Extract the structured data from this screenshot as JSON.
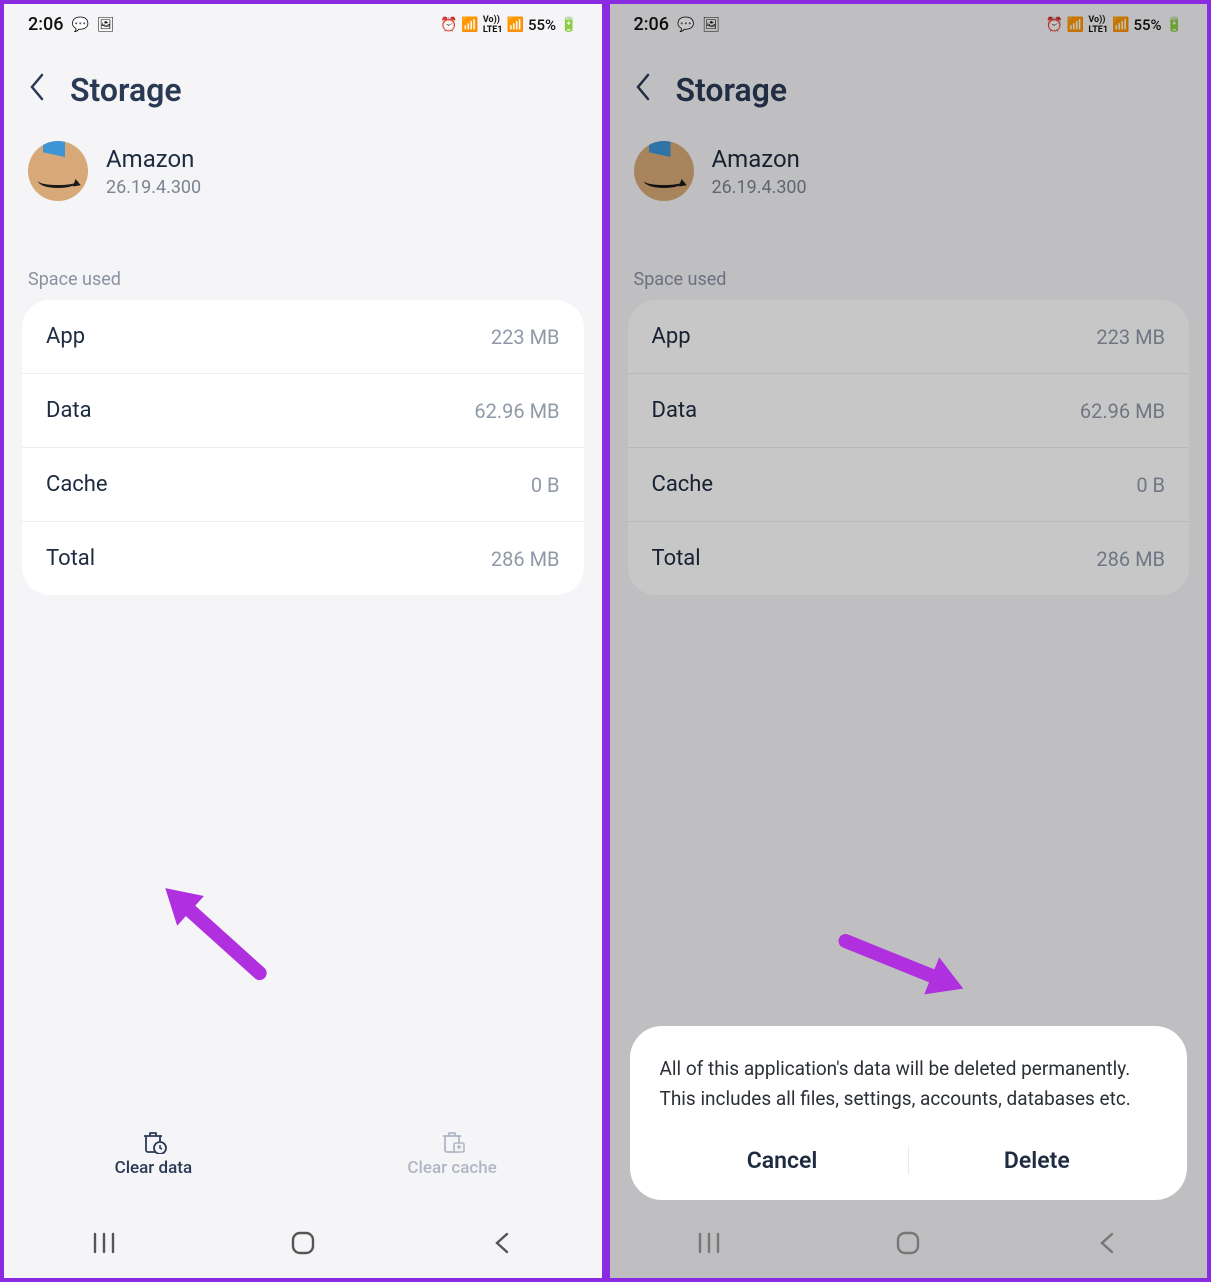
{
  "status": {
    "time": "2:06",
    "battery": "55%"
  },
  "header": {
    "title": "Storage"
  },
  "app": {
    "name": "Amazon",
    "version": "26.19.4.300"
  },
  "section_label": "Space used",
  "rows": {
    "app": {
      "label": "App",
      "value": "223 MB"
    },
    "data": {
      "label": "Data",
      "value": "62.96 MB"
    },
    "cache": {
      "label": "Cache",
      "value": "0 B"
    },
    "total": {
      "label": "Total",
      "value": "286 MB"
    }
  },
  "actions": {
    "clear_data": "Clear data",
    "clear_cache": "Clear cache"
  },
  "dialog": {
    "message": "All of this application's data will be deleted permanently. This includes all files, settings, accounts, databases etc.",
    "cancel": "Cancel",
    "delete": "Delete"
  }
}
